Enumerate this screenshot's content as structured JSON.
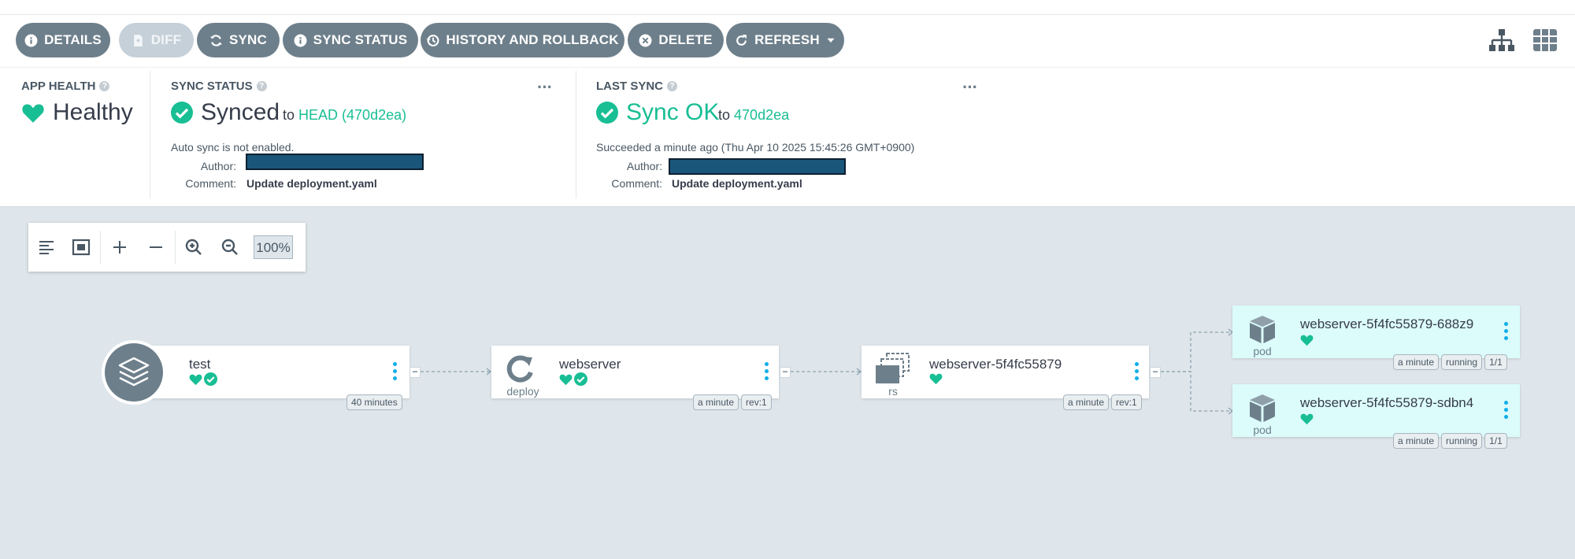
{
  "toolbar": {
    "buttons": [
      {
        "label": "DETAILS",
        "icon": "info-icon"
      },
      {
        "label": "DIFF",
        "icon": "file-diff-icon",
        "disabled": true
      },
      {
        "label": "SYNC",
        "icon": "sync-icon"
      },
      {
        "label": "SYNC STATUS",
        "icon": "info-icon"
      },
      {
        "label": "HISTORY AND ROLLBACK",
        "icon": "history-icon"
      },
      {
        "label": "DELETE",
        "icon": "close-circle-icon"
      },
      {
        "label": "REFRESH",
        "icon": "refresh-icon",
        "dropdown": true
      }
    ],
    "view_icons": [
      "tree-view-icon",
      "grid-view-icon"
    ]
  },
  "app_health": {
    "label": "APP HEALTH",
    "status": "Healthy",
    "color": "#18be94"
  },
  "sync_status": {
    "label": "SYNC STATUS",
    "status": "Synced",
    "to_prefix": "to",
    "to_target": "HEAD (470d2ea)",
    "auto_sync_note": "Auto sync is not enabled.",
    "author_key": "Author:",
    "comment_key": "Comment:",
    "comment": "Update deployment.yaml"
  },
  "last_sync": {
    "label": "LAST SYNC",
    "status": "Sync OK",
    "to_prefix": "to",
    "to_target": "470d2ea",
    "succeeded": "Succeeded a minute ago (Thu Apr 10 2025 15:45:26 GMT+0900)",
    "author_key": "Author:",
    "comment_key": "Comment:",
    "comment": "Update deployment.yaml"
  },
  "zoom": {
    "level": "100%"
  },
  "nodes": {
    "app": {
      "title": "test",
      "tags": [
        "40 minutes"
      ]
    },
    "deploy": {
      "title": "webserver",
      "kind": "deploy",
      "tags": [
        "a minute",
        "rev:1"
      ]
    },
    "rs": {
      "title": "webserver-5f4fc55879",
      "kind": "rs",
      "tags": [
        "a minute",
        "rev:1"
      ]
    },
    "pod1": {
      "title": "webserver-5f4fc55879-688z9",
      "kind": "pod",
      "tags": [
        "a minute",
        "running",
        "1/1"
      ]
    },
    "pod2": {
      "title": "webserver-5f4fc55879-sdbn4",
      "kind": "pod",
      "tags": [
        "a minute",
        "running",
        "1/1"
      ]
    }
  },
  "colors": {
    "accent": "#18be94",
    "button": "#6d7f8b",
    "canvas": "#dee6eb",
    "pod": "#dcfbfb"
  }
}
